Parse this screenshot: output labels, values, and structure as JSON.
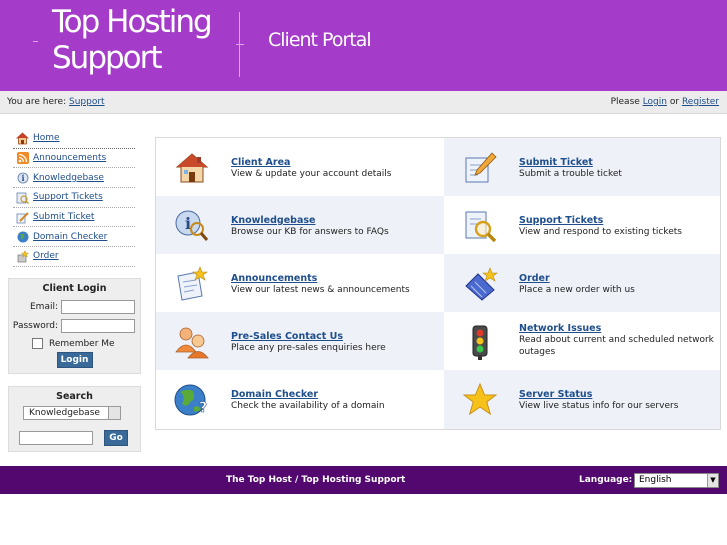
{
  "header": {
    "logo_line1": "Top Hosting",
    "logo_line2": "Support",
    "portal_title": "Client Portal"
  },
  "breadcrumb": {
    "label": "You are here:",
    "link": "Support"
  },
  "account_links": {
    "prefix": "Please",
    "login": "Login",
    "or": "or",
    "register": "Register"
  },
  "sidebar": {
    "items": [
      {
        "label": "Home",
        "icon": "home-icon"
      },
      {
        "label": "Announcements",
        "icon": "rss-icon"
      },
      {
        "label": "Knowledgebase",
        "icon": "knowledgebase-icon"
      },
      {
        "label": "Support Tickets",
        "icon": "tickets-icon"
      },
      {
        "label": "Submit Ticket",
        "icon": "submit-ticket-icon"
      },
      {
        "label": "Domain Checker",
        "icon": "globe-icon"
      },
      {
        "label": "Order",
        "icon": "order-icon"
      }
    ]
  },
  "client_login": {
    "title": "Client Login",
    "email_label": "Email:",
    "password_label": "Password:",
    "remember_label": "Remember Me",
    "login_button": "Login"
  },
  "search": {
    "title": "Search",
    "scope": "Knowledgebase",
    "go_button": "Go"
  },
  "tiles": [
    {
      "title": "Client Area",
      "desc": "View & update your account details",
      "icon": "house-icon"
    },
    {
      "title": "Submit Ticket",
      "desc": "Submit a trouble ticket",
      "icon": "pencil-document-icon"
    },
    {
      "title": "Knowledgebase",
      "desc": "Browse our KB for answers to FAQs",
      "icon": "info-magnifier-icon"
    },
    {
      "title": "Support Tickets",
      "desc": "View and respond to existing tickets",
      "icon": "ticket-magnifier-icon"
    },
    {
      "title": "Announcements",
      "desc": "View our latest news & announcements",
      "icon": "news-star-icon"
    },
    {
      "title": "Order",
      "desc": "Place a new order with us",
      "icon": "order-box-icon"
    },
    {
      "title": "Pre-Sales Contact Us",
      "desc": "Place any pre-sales enquiries here",
      "icon": "people-icon"
    },
    {
      "title": "Network Issues",
      "desc": "Read about current and scheduled network outages",
      "icon": "traffic-light-icon"
    },
    {
      "title": "Domain Checker",
      "desc": "Check the availability of a domain",
      "icon": "globe-question-icon"
    },
    {
      "title": "Server Status",
      "desc": "View live status info for our servers",
      "icon": "star-icon"
    }
  ],
  "footer": {
    "text": "The Top Host / Top Hosting Support",
    "language_label": "Language:",
    "language_value": "English"
  },
  "colors": {
    "header_purple": "#a43cc9",
    "footer_purple": "#52086f",
    "link_blue": "#1f4e8c",
    "button_blue": "#3a6a99"
  }
}
